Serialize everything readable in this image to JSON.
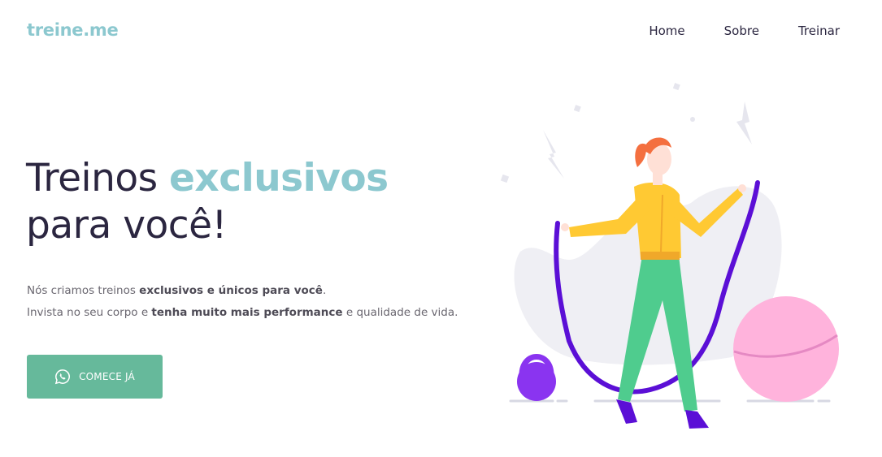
{
  "header": {
    "logo": "treine.me",
    "nav": [
      {
        "label": "Home"
      },
      {
        "label": "Sobre"
      },
      {
        "label": "Treinar"
      }
    ]
  },
  "hero": {
    "title_prefix": "Treinos ",
    "title_highlight": "exclusivos",
    "title_suffix": "para você!",
    "line1_prefix": "Nós criamos treinos ",
    "line1_bold": "exclusivos e únicos para você",
    "line1_suffix": ".",
    "line2_prefix": "Invista no seu corpo e ",
    "line2_bold": "tenha muito mais performance",
    "line2_suffix": " e qualidade de vida.",
    "cta_label": "COMECE JÁ",
    "cta_icon": "whatsapp-icon"
  },
  "colors": {
    "brand": "#8cc8cf",
    "cta": "#66b99b",
    "text": "#2b2640"
  }
}
